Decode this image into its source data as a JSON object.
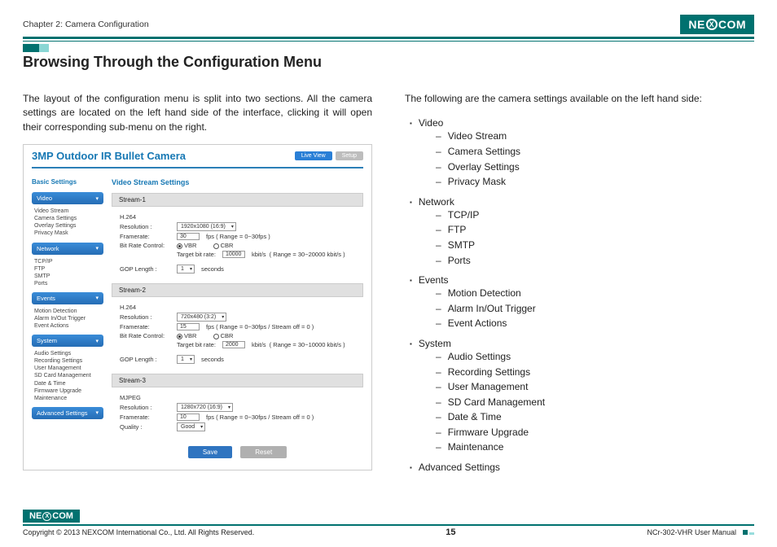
{
  "header": {
    "chapter": "Chapter 2: Camera Configuration",
    "logo_pre": "NE",
    "logo_x": "X",
    "logo_post": "COM"
  },
  "title": "Browsing Through the Configuration Menu",
  "left_intro": "The layout of the configuration menu is split into two sections. All the camera settings are located on the left hand side of the interface, clicking it will open their corresponding sub-menu on the right.",
  "right_intro": "The following are the camera settings available on the left hand side:",
  "settings_list": [
    {
      "label": "Video",
      "items": [
        "Video Stream",
        "Camera Settings",
        "Overlay Settings",
        "Privacy Mask"
      ]
    },
    {
      "label": "Network",
      "items": [
        "TCP/IP",
        "FTP",
        "SMTP",
        "Ports"
      ]
    },
    {
      "label": "Events",
      "items": [
        "Motion Detection",
        "Alarm In/Out Trigger",
        "Event Actions"
      ]
    },
    {
      "label": "System",
      "items": [
        "Audio Settings",
        "Recording Settings",
        "User Management",
        "SD Card Management",
        "Date & Time",
        "Firmware Upgrade",
        "Maintenance"
      ]
    },
    {
      "label": "Advanced Settings",
      "items": []
    }
  ],
  "shot": {
    "title": "3MP Outdoor IR Bullet Camera",
    "btn_live": "Live View",
    "btn_setup": "Setup",
    "sidebar_title": "Basic Settings",
    "groups": [
      {
        "head": "Video",
        "items": [
          "Video Stream",
          "Camera Settings",
          "Overlay Settings",
          "Privacy Mask"
        ]
      },
      {
        "head": "Network",
        "items": [
          "TCP/IP",
          "FTP",
          "SMTP",
          "Ports"
        ]
      },
      {
        "head": "Events",
        "items": [
          "Motion Detection",
          "Alarm In/Out Trigger",
          "Event Actions"
        ]
      },
      {
        "head": "System",
        "items": [
          "Audio Settings",
          "Recording Settings",
          "User Management",
          "SD Card Management",
          "Date & Time",
          "Firmware Upgrade",
          "Maintenance"
        ]
      },
      {
        "head": "Advanced Settings",
        "items": []
      }
    ],
    "panel_title": "Video Stream Settings",
    "labels": {
      "resolution": "Resolution :",
      "framerate": "Framerate:",
      "bitrate_ctrl": "Bit Rate Control:",
      "target_bitrate": "Target bit rate:",
      "gop": "GOP Length :",
      "quality": "Quality :",
      "vbr": "VBR",
      "cbr": "CBR",
      "seconds": "seconds",
      "kbits": "kbit/s"
    },
    "streams": [
      {
        "head": "Stream-1",
        "codec": "H.264",
        "resolution": "1920x1080 (16:9)",
        "framerate": "30",
        "fps_range": "fps  ( Range = 0~30fps )",
        "target": "10000",
        "target_range": "( Range = 30~20000 kbit/s )",
        "gop": "1"
      },
      {
        "head": "Stream-2",
        "codec": "H.264",
        "resolution": "720x480 (3:2)",
        "framerate": "15",
        "fps_range": "fps  ( Range = 0~30fps / Stream off = 0 )",
        "target": "2000",
        "target_range": "( Range = 30~10000 kbit/s )",
        "gop": "1"
      },
      {
        "head": "Stream-3",
        "codec": "MJPEG",
        "resolution": "1280x720 (16:9)",
        "framerate": "10",
        "fps_range": "fps  ( Range = 0~30fps / Stream off = 0 )",
        "quality": "Good"
      }
    ],
    "btn_save": "Save",
    "btn_reset": "Reset"
  },
  "footer": {
    "copyright": "Copyright © 2013 NEXCOM International Co., Ltd. All Rights Reserved.",
    "page": "15",
    "manual": "NCr-302-VHR User Manual"
  }
}
